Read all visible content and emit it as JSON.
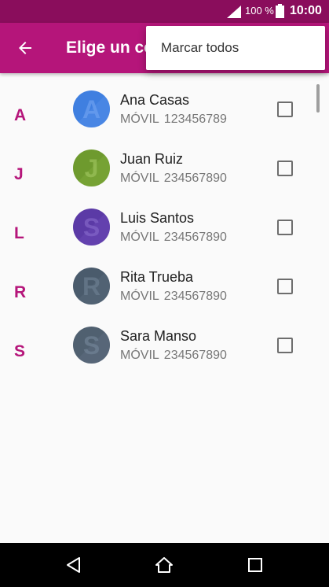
{
  "status_bar": {
    "battery": "100 %",
    "time": "10:00",
    "signal_icon": "signal-icon",
    "battery_icon": "battery-icon"
  },
  "app_bar": {
    "title": "Elige un co",
    "back_icon": "arrow-back-icon"
  },
  "overflow_menu": {
    "items": [
      {
        "label": "Marcar todos"
      }
    ]
  },
  "contacts": [
    {
      "letter": "A",
      "name": "Ana Casas",
      "phone_label": "MÓVIL",
      "phone": "123456789",
      "avatar_color": "#3f7fe0",
      "avatar_letter": "A",
      "checked": false
    },
    {
      "letter": "J",
      "name": "Juan Ruiz",
      "phone_label": "MÓVIL",
      "phone": "234567890",
      "avatar_color": "#6e9a2e",
      "avatar_letter": "J",
      "checked": false
    },
    {
      "letter": "L",
      "name": "Luis Santos",
      "phone_label": "MÓVIL",
      "phone": "234567890",
      "avatar_color": "#5b3aa6",
      "avatar_letter": "S",
      "checked": false
    },
    {
      "letter": "R",
      "name": "Rita Trueba",
      "phone_label": "MÓVIL",
      "phone": "234567890",
      "avatar_color": "#4a5b6c",
      "avatar_letter": "R",
      "checked": false
    },
    {
      "letter": "S",
      "name": "Sara Manso",
      "phone_label": "MÓVIL",
      "phone": "234567890",
      "avatar_color": "#506070",
      "avatar_letter": "S",
      "checked": false
    }
  ],
  "nav_bar": {
    "back_icon": "nav-back-icon",
    "home_icon": "nav-home-icon",
    "recents_icon": "nav-recents-icon"
  },
  "colors": {
    "status_bar": "#8a0d5c",
    "app_bar": "#b5157a",
    "accent": "#b5157a"
  }
}
